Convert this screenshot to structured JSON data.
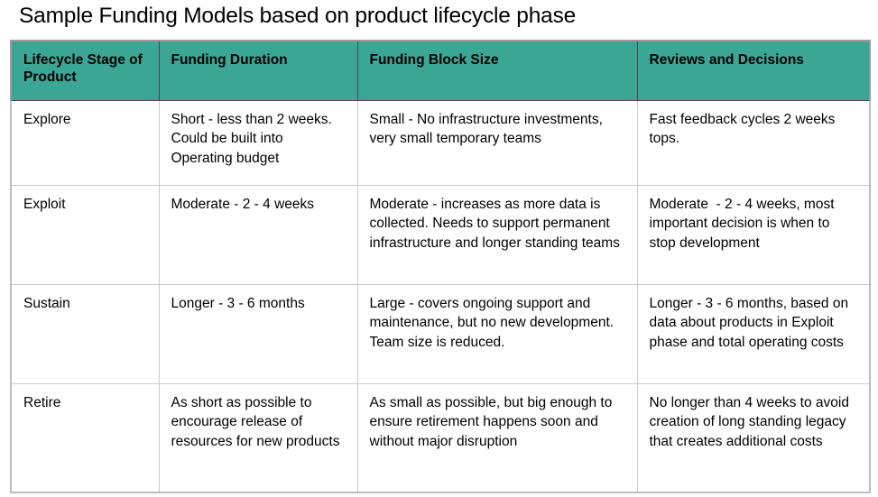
{
  "title": "Sample Funding Models based on product lifecycle phase",
  "theme": {
    "header_background": "#3BA695",
    "header_text": "#000000",
    "body_text": "#000000",
    "grid_line": "#c9c9c9",
    "outer_border": "#9a9a9a",
    "page_background": "#ffffff"
  },
  "table": {
    "columns": [
      {
        "key": "stage",
        "label": "Lifecycle Stage of Product"
      },
      {
        "key": "duration",
        "label": "Funding Duration"
      },
      {
        "key": "block",
        "label": "Funding Block Size"
      },
      {
        "key": "reviews",
        "label": "Reviews and Decisions"
      }
    ],
    "rows": [
      {
        "stage": "Explore",
        "duration": "Short - less than 2 weeks. Could be built into Operating budget",
        "block": "Small - No infrastructure investments, very small temporary teams",
        "reviews": "Fast feedback cycles 2 weeks tops."
      },
      {
        "stage": "Exploit",
        "duration": "Moderate - 2 - 4 weeks",
        "block": "Moderate - increases as more data is collected. Needs to support permanent infrastructure and longer standing teams",
        "reviews": "Moderate  - 2 - 4 weeks, most important decision is when to stop development"
      },
      {
        "stage": "Sustain",
        "duration": "Longer - 3 - 6 months",
        "block": "Large - covers ongoing support and maintenance, but no new development. Team size is reduced.",
        "reviews": "Longer - 3 - 6 months, based on data about products in Exploit phase and total operating costs"
      },
      {
        "stage": "Retire",
        "duration": "As short as possible to encourage release of resources for new products",
        "block": "As small as possible, but big enough to ensure retirement happens soon and without major disruption",
        "reviews": "No longer than 4 weeks to avoid creation of long standing legacy that creates additional costs"
      }
    ]
  }
}
